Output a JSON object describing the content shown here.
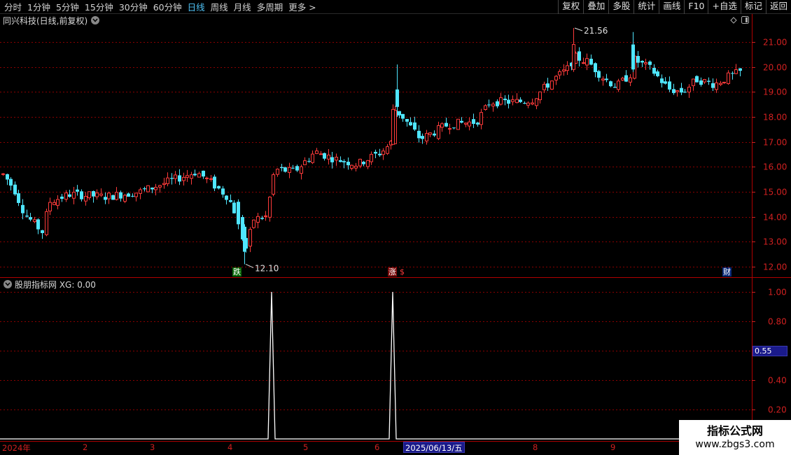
{
  "topbar": {
    "periods": [
      "分时",
      "1分钟",
      "5分钟",
      "15分钟",
      "30分钟",
      "60分钟",
      "日线",
      "周线",
      "月线",
      "多周期",
      "更多 >"
    ],
    "active_period": "日线",
    "tools": [
      "复权",
      "叠加",
      "多股",
      "统计",
      "画线",
      "F10",
      "+自选",
      "标记",
      "返回"
    ]
  },
  "main_chart": {
    "title": "同兴科技(日线,前复权)",
    "price_ticks": [
      "21.00",
      "20.00",
      "19.00",
      "18.00",
      "17.00",
      "16.00",
      "15.00",
      "14.00",
      "13.00",
      "12.00"
    ],
    "high_label": "21.56",
    "low_label": "12.10",
    "events": {
      "fall": "跌",
      "rise": "涨",
      "dollar": "$",
      "finance": "财"
    }
  },
  "indicator": {
    "title": "股朋指标网  XG: 0.00",
    "ticks": [
      "1.00",
      "0.80",
      "0.40",
      "0.20"
    ],
    "cursor_value": "0.55"
  },
  "date_axis": {
    "labels": [
      "2024年",
      "2",
      "3",
      "4",
      "5",
      "6",
      "8",
      "9"
    ],
    "cursor_date": "2025/06/13/五"
  },
  "watermark": {
    "line1": "指标公式网",
    "line2": "www.zbgs3.com"
  },
  "colors": {
    "up": "#ff3b3b",
    "down": "#4fe6ff",
    "grid": "#8a0000",
    "axis": "#d02020",
    "indicator_line": "#ffffff"
  },
  "chart_data": {
    "type": "candlestick",
    "ylim": [
      11.6,
      21.9
    ],
    "peaks_xg": [
      1,
      1
    ],
    "high": 21.56,
    "low": 12.1
  }
}
